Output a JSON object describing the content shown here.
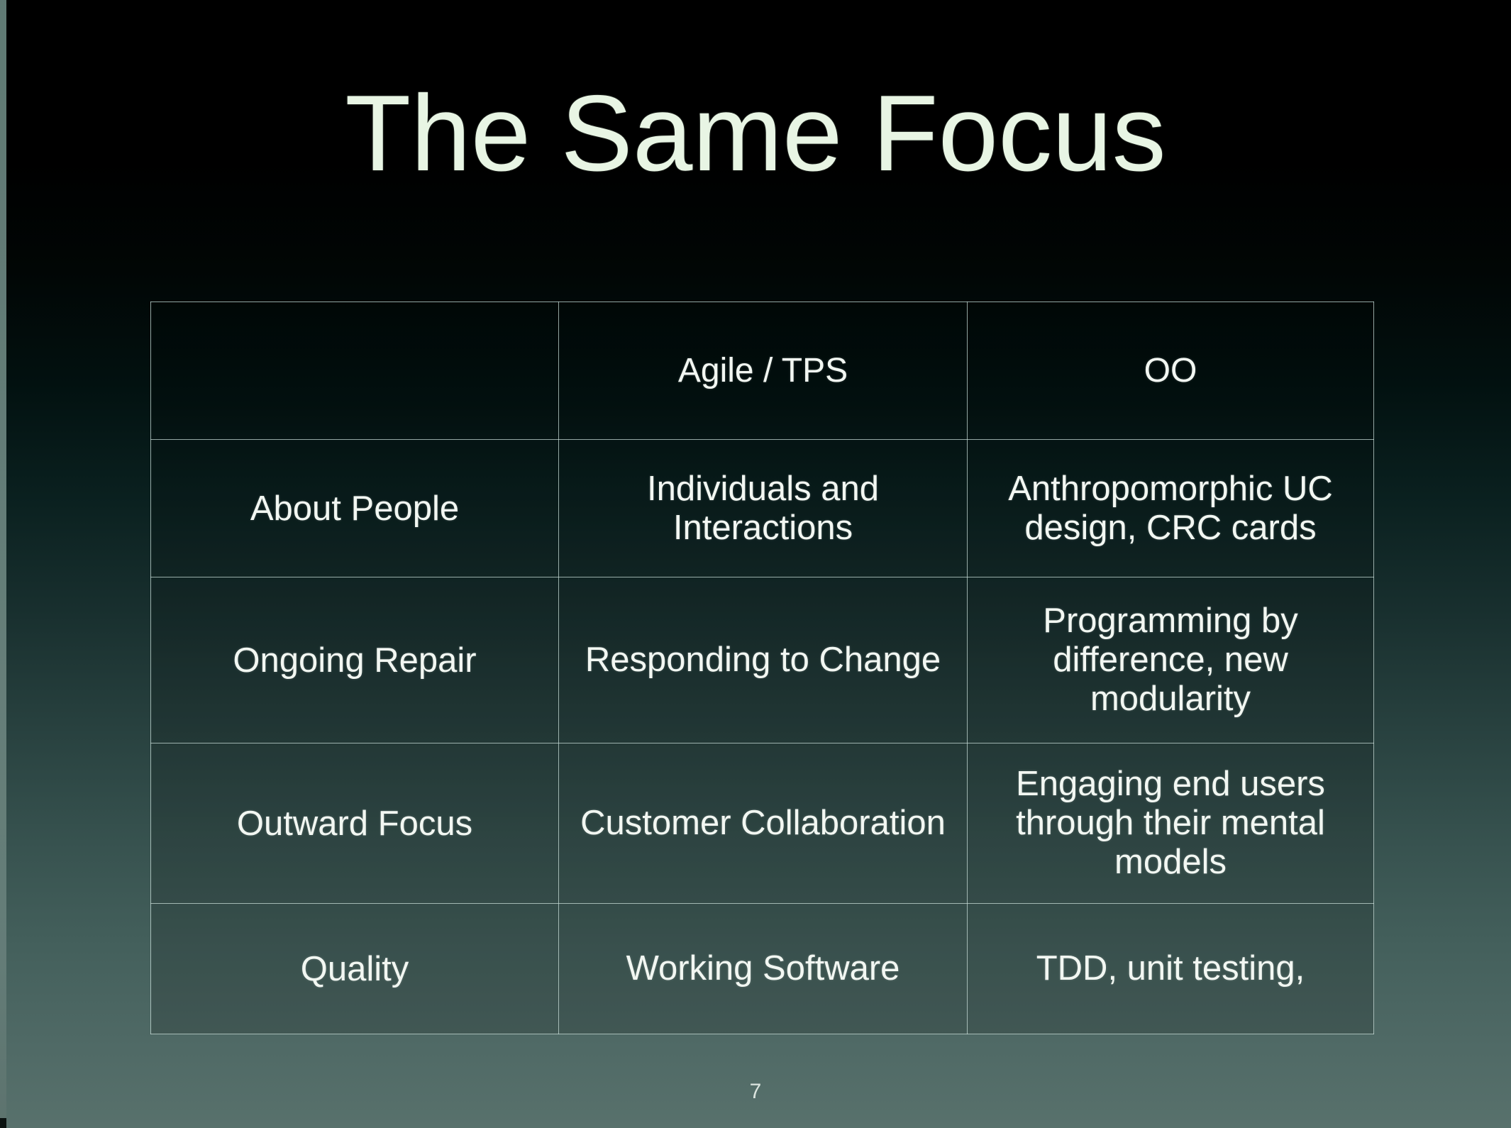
{
  "slide": {
    "title": "The Same Focus",
    "page_number": "7",
    "colors": {
      "title_text": "#e8f5e4",
      "body_text": "#f2f7f2",
      "table_border": "#cde2dc",
      "background_top": "#000000",
      "background_bottom": "#58716c",
      "left_edge_strip": "#6d8a84"
    }
  },
  "table": {
    "headers": [
      "",
      "Agile / TPS",
      "OO"
    ],
    "rows": [
      {
        "label": "About People",
        "agile_tps": "Individuals and Interactions",
        "oo": "Anthropomorphic UC design, CRC cards"
      },
      {
        "label": "Ongoing Repair",
        "agile_tps": "Responding to Change",
        "oo": "Programming by difference, new modularity"
      },
      {
        "label": "Outward Focus",
        "agile_tps": "Customer Collaboration",
        "oo": "Engaging end users through their mental models"
      },
      {
        "label": "Quality",
        "agile_tps": "Working Software",
        "oo": "TDD, unit testing,"
      }
    ]
  }
}
